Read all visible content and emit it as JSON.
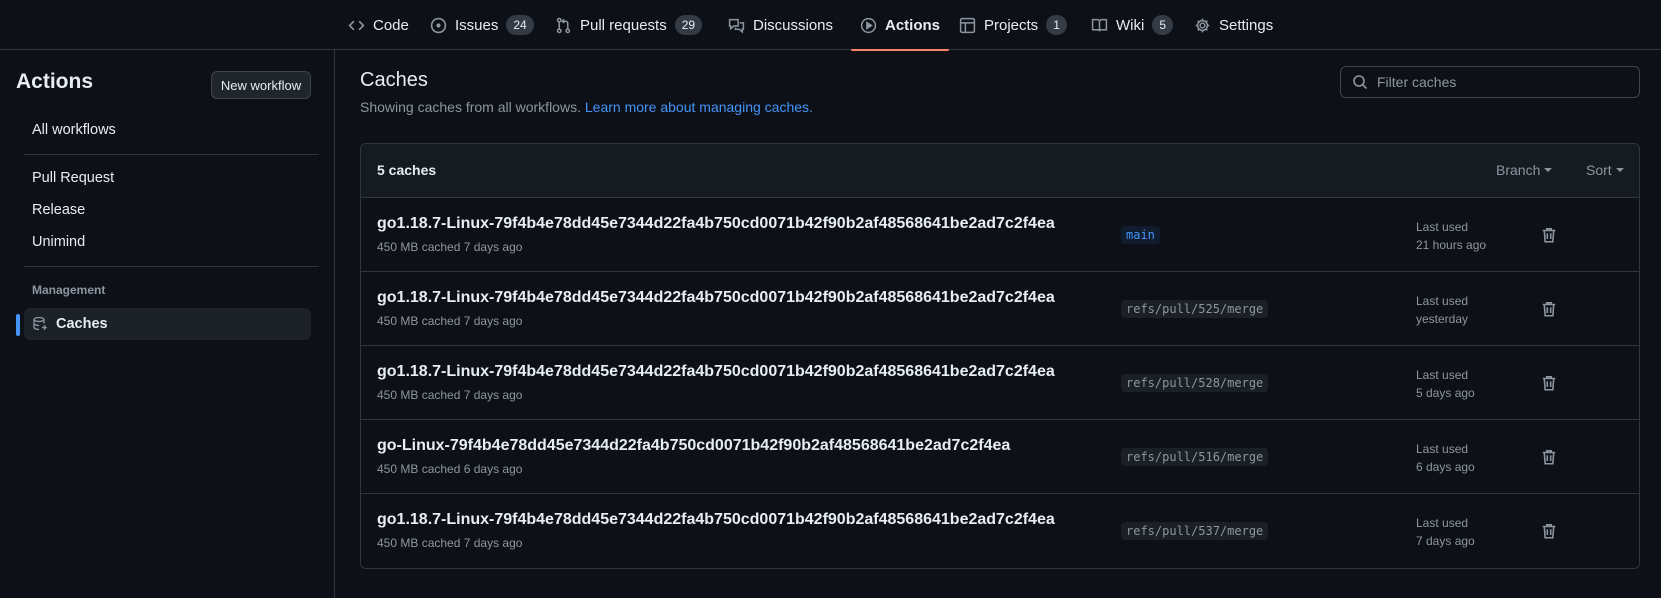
{
  "nav": {
    "tabs": [
      {
        "label": "Code",
        "icon": "code-icon"
      },
      {
        "label": "Issues",
        "icon": "issue-icon",
        "count": "24"
      },
      {
        "label": "Pull requests",
        "icon": "pull-request-icon",
        "count": "29"
      },
      {
        "label": "Discussions",
        "icon": "discussions-icon"
      },
      {
        "label": "Actions",
        "icon": "play-icon",
        "active": true
      },
      {
        "label": "Projects",
        "icon": "table-icon",
        "count": "1"
      },
      {
        "label": "Wiki",
        "icon": "book-icon",
        "count": "5"
      },
      {
        "label": "Settings",
        "icon": "gear-icon"
      }
    ],
    "active_underline_color": "#f78166"
  },
  "sidebar": {
    "title": "Actions",
    "new_workflow_label": "New workflow",
    "all_workflows": "All workflows",
    "workflows": [
      "Pull Request",
      "Release",
      "Unimind"
    ],
    "management_heading": "Management",
    "caches_label": "Caches",
    "caches_icon": "database-icon",
    "accent_color": "#4493f8"
  },
  "main": {
    "title": "Caches",
    "subtitle": "Showing caches from all workflows.",
    "learn_more": "Learn more about managing caches.",
    "filter_placeholder": "Filter caches",
    "box": {
      "count_label": "5 caches",
      "branch_menu": "Branch",
      "sort_menu": "Sort",
      "last_used_label": "Last used",
      "rows": [
        {
          "key": "go1.18.7-Linux-79f4b4e78dd45e7344d22fa4b750cd0071b42f90b2af48568641be2ad7c2f4ea",
          "meta": "450 MB cached 7 days ago",
          "branch": "main",
          "last_used": "21 hours ago"
        },
        {
          "key": "go1.18.7-Linux-79f4b4e78dd45e7344d22fa4b750cd0071b42f90b2af48568641be2ad7c2f4ea",
          "meta": "450 MB cached 7 days ago",
          "branch": "refs/pull/525/merge",
          "last_used": "yesterday"
        },
        {
          "key": "go1.18.7-Linux-79f4b4e78dd45e7344d22fa4b750cd0071b42f90b2af48568641be2ad7c2f4ea",
          "meta": "450 MB cached 7 days ago",
          "branch": "refs/pull/528/merge",
          "last_used": "5 days ago"
        },
        {
          "key": "go-Linux-79f4b4e78dd45e7344d22fa4b750cd0071b42f90b2af48568641be2ad7c2f4ea",
          "meta": "450 MB cached 6 days ago",
          "branch": "refs/pull/516/merge",
          "last_used": "6 days ago"
        },
        {
          "key": "go1.18.7-Linux-79f4b4e78dd45e7344d22fa4b750cd0071b42f90b2af48568641be2ad7c2f4ea",
          "meta": "450 MB cached 7 days ago",
          "branch": "refs/pull/537/merge",
          "last_used": "7 days ago"
        }
      ]
    }
  }
}
